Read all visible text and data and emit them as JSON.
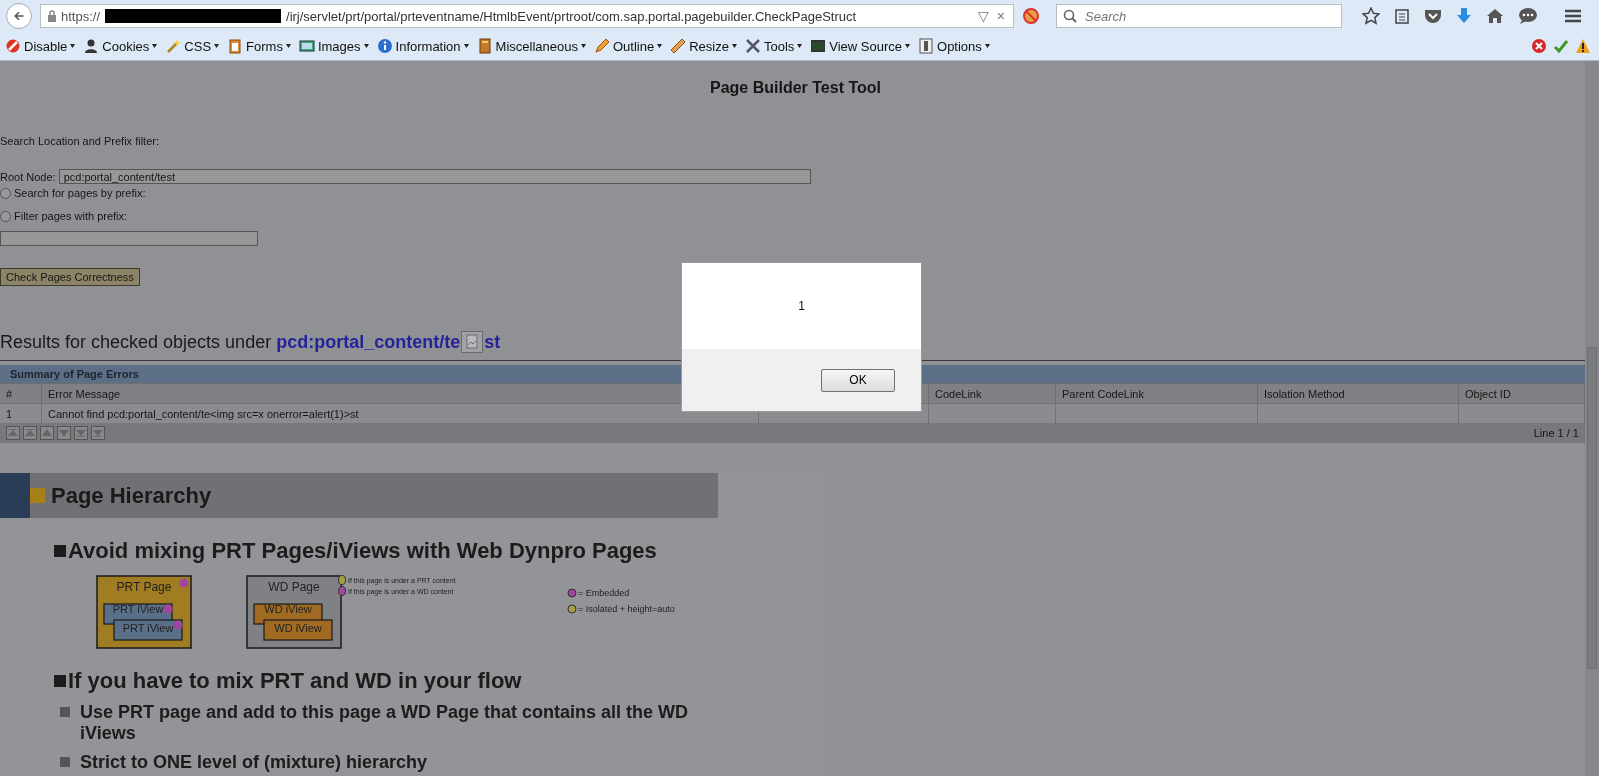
{
  "browser": {
    "url_scheme": "https://",
    "url_path": "/irj/servlet/prt/portal/prteventname/HtmlbEvent/prtroot/com.sap.portal.pagebuilder.CheckPageStruct",
    "url_dropdown": "▽",
    "url_clear": "×",
    "search_placeholder": "Search"
  },
  "toolbar": [
    "Disable",
    "Cookies",
    "CSS",
    "Forms",
    "Images",
    "Information",
    "Miscellaneous",
    "Outline",
    "Resize",
    "Tools",
    "View Source",
    "Options"
  ],
  "page": {
    "title": "Page Builder Test Tool",
    "filter_label": "Search Location and Prefix filter:",
    "root_node": {
      "label": "Root Node:",
      "value": "pcd:portal_content/test"
    },
    "options": [
      {
        "label": "Search for pages by prefix:",
        "selected": false
      },
      {
        "label": "Filter pages with prefix:",
        "selected": false
      }
    ],
    "check_button": "Check Pages Correctness",
    "results": {
      "text": "Results for checked objects under",
      "link_before": "pcd:portal_content/te",
      "link_after": "st"
    },
    "table": {
      "title": "Summary of Page Errors",
      "columns": [
        "#",
        "Error Message",
        "CodeLink",
        "Parent CodeLink",
        "Isolation Method",
        "Object ID"
      ],
      "rows": [
        {
          "cells": [
            "1",
            "Cannot find pcd:portal_content/te<img src=x onerror=alert(1)>st"
          ]
        }
      ],
      "footer": "Line 1 / 1"
    },
    "slide": {
      "title": "Page Hierarchy",
      "bullets": [
        {
          "text": "Avoid mixing PRT Pages/iViews with Web Dynpro Pages"
        },
        {
          "text": "If you have to mix PRT and WD in your flow",
          "children": [
            {
              "text": "Use PRT page and add to this page a WD Page that contains all the WD iViews"
            },
            {
              "text": "Strict to ONE level of (mixture) hierarchy"
            }
          ]
        }
      ],
      "diagram": {
        "containers": [
          {
            "kind": "prt",
            "title": "PRT Page",
            "color": "#a046a0",
            "iviews": [
              {
                "label": "PRT iView",
                "color": "#a046a0"
              },
              {
                "label": "PRT iView",
                "color": "#a046a0"
              }
            ]
          },
          {
            "kind": "wd",
            "title": "WD Page",
            "iviews": [
              {
                "label": "WD iView"
              },
              {
                "label": "WD iView"
              }
            ]
          }
        ],
        "notes": [
          {
            "text": "If this page is under a PRT content",
            "color": "#a4a040"
          },
          {
            "text": "If this page is under a WD content",
            "color": "#a046a0"
          }
        ],
        "legend": [
          {
            "text": "= Embedded",
            "color": "#a046a0"
          },
          {
            "text": "= Isolated + height=auto",
            "color": "#a4a040"
          }
        ]
      }
    }
  },
  "dialog": {
    "message": "1",
    "button": "OK"
  }
}
